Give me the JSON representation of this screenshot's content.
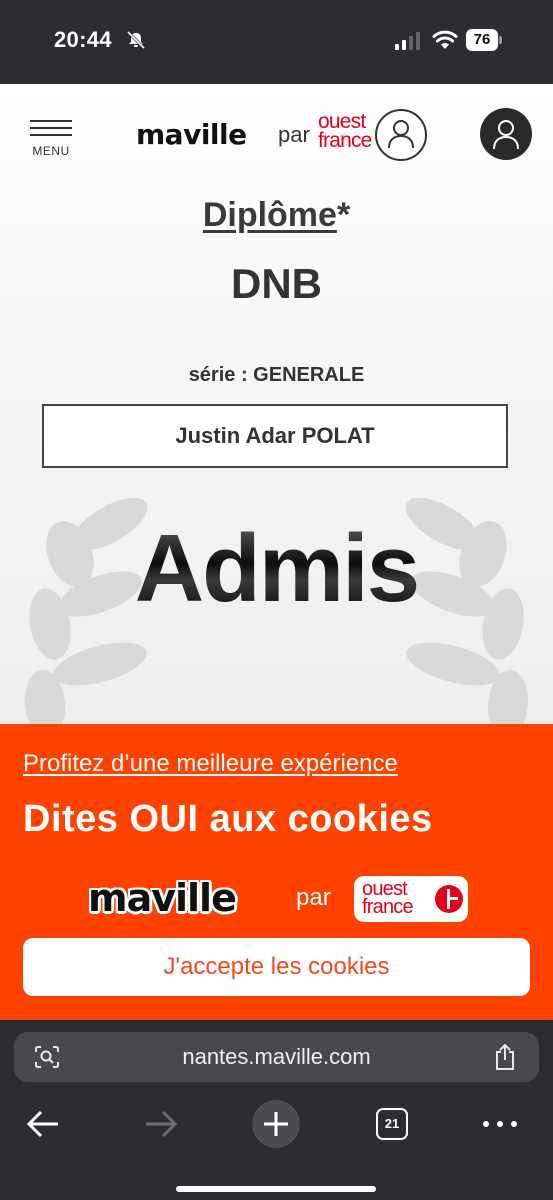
{
  "status_bar": {
    "time": "20:44",
    "battery": "76"
  },
  "site": {
    "menu_label": "MENU",
    "logo_maville": "maville",
    "logo_par": "par",
    "logo_ouest_france": "ouest france"
  },
  "result": {
    "diplome_label": "Diplôme",
    "diplome_asterisk": "*",
    "diplome_value": "DNB",
    "serie": "série : GENERALE",
    "candidate_name": "Justin Adar POLAT",
    "status": "Admis"
  },
  "cookie_banner": {
    "link_text": "Profitez d’une meilleure expérience",
    "title": "Dites OUI aux cookies",
    "logo_maville": "maville",
    "logo_par": "par",
    "logo_ouest_france": "ouest france",
    "accept_label": "J'accepte les cookies",
    "background_color": "#ff4200"
  },
  "browser": {
    "url": "nantes.maville.com",
    "tab_count": "21"
  },
  "icons": {
    "status": [
      "mute-icon",
      "signal-icon",
      "wifi-icon",
      "battery-icon"
    ],
    "header": [
      "menu-icon",
      "user-outline-icon",
      "account-icon"
    ],
    "browser": [
      "lens-icon",
      "share-icon",
      "back-arrow-icon",
      "forward-arrow-icon",
      "plus-icon",
      "tabs-icon",
      "more-icon"
    ]
  }
}
